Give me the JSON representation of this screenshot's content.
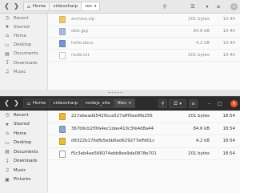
{
  "top_window": {
    "breadcrumbs": [
      {
        "label": "Home",
        "icon": "home-icon"
      },
      {
        "label": "videosharp"
      },
      {
        "label": "res",
        "active": true
      }
    ],
    "sidebar": [
      {
        "label": "Recent",
        "icon": "clock-icon"
      },
      {
        "label": "Starred",
        "icon": "star-icon"
      },
      {
        "label": "Home",
        "icon": "home-icon"
      },
      {
        "label": "Desktop",
        "icon": "desktop-icon"
      },
      {
        "label": "Documents",
        "icon": "document-icon"
      },
      {
        "label": "Downloads",
        "icon": "download-icon"
      },
      {
        "label": "Music",
        "icon": "music-icon"
      }
    ],
    "files": [
      {
        "name": "archive.zip",
        "size": "201 bytes",
        "modified": "10:40",
        "type": "zip"
      },
      {
        "name": "disk.jpg",
        "size": "84.6 kB",
        "modified": "10:40",
        "type": "image"
      },
      {
        "name": "hello.docx",
        "size": "4.2 kB",
        "modified": "10:40",
        "type": "doc"
      },
      {
        "name": "node.txt",
        "size": "201 bytes",
        "modified": "10:40",
        "type": "text"
      }
    ]
  },
  "bottom_window": {
    "breadcrumbs": [
      {
        "label": "Home",
        "icon": "home-icon"
      },
      {
        "label": "videosharp"
      },
      {
        "label": "nodejs_site"
      },
      {
        "label": "files",
        "active": true
      }
    ],
    "sidebar": [
      {
        "label": "Recent",
        "icon": "clock-icon"
      },
      {
        "label": "Starred",
        "icon": "star-icon"
      },
      {
        "label": "Home",
        "icon": "home-icon"
      },
      {
        "label": "Desktop",
        "icon": "desktop-icon"
      },
      {
        "label": "Documents",
        "icon": "document-icon"
      },
      {
        "label": "Downloads",
        "icon": "download-icon"
      },
      {
        "label": "Music",
        "icon": "music-icon"
      },
      {
        "label": "Pictures",
        "icon": "picture-icon"
      }
    ],
    "files": [
      {
        "name": "227abeadd5429cca527afff0ae9fb256",
        "size": "201 bytes",
        "modified": "18:54",
        "type": "zip"
      },
      {
        "name": "367b6cb2f0fa4ec1dae410c3fe4d8a44",
        "size": "84.6 kB",
        "modified": "18:54",
        "type": "image"
      },
      {
        "name": "d9322b176dfb5ebb6ed629277effd01c",
        "size": "4.2 kB",
        "modified": "18:54",
        "type": "pdf"
      },
      {
        "name": "f5c3eb4ae566074ebb8ee9da0878e701",
        "size": "201 bytes",
        "modified": "18:54",
        "type": "generic"
      }
    ]
  },
  "colors": {
    "accent": "#e95420",
    "dark_header": "#2c2c2c",
    "light_header": "#e8e8e7"
  }
}
